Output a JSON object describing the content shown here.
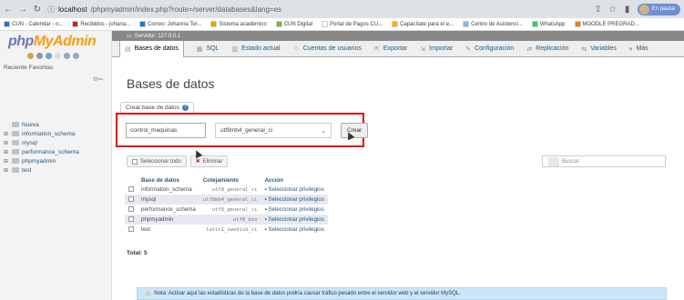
{
  "browser": {
    "url_host": "localhost",
    "url_path": "/phpmyadmin/index.php?route=/server/databases&lang=es",
    "profile_label": "En pausa"
  },
  "bookmarks": [
    {
      "label": "CUN - Calendar - o...",
      "color": "#2b6fd6"
    },
    {
      "label": "Recibidos - johana...",
      "color": "#c5221f"
    },
    {
      "label": "Correo: Johanna Ter...",
      "color": "#1a73e8"
    },
    {
      "label": "Sistema académico",
      "color": "#e8a400"
    },
    {
      "label": "CUN Digital",
      "color": "#7cb342"
    },
    {
      "label": "Portal de Pagos CU...",
      "color": "#ffffff"
    },
    {
      "label": "Capacítate para el e...",
      "color": "#ffb300"
    },
    {
      "label": "Centro de Asistenci...",
      "color": "#8ab4f8"
    },
    {
      "label": "WhatsApp",
      "color": "#25d366"
    },
    {
      "label": "MOODLE PREGRAD...",
      "color": "#f57c00"
    }
  ],
  "sidebar": {
    "logo_php": "php",
    "logo_myadmin": "MyAdmin",
    "recent_label": "Reciente",
    "favorites_label": "Favoritas",
    "tree": [
      {
        "label": "Nueva",
        "kind": "new"
      },
      {
        "label": "information_schema",
        "kind": "db"
      },
      {
        "label": "mysql",
        "kind": "db"
      },
      {
        "label": "performance_schema",
        "kind": "db"
      },
      {
        "label": "phpmyadmin",
        "kind": "db"
      },
      {
        "label": "test",
        "kind": "db"
      }
    ]
  },
  "serverbar": {
    "label": "Servidor: 127.0.0.1"
  },
  "tabs": [
    {
      "label": "Bases de datos",
      "active": true
    },
    {
      "label": "SQL",
      "active": false
    },
    {
      "label": "Estado actual",
      "active": false
    },
    {
      "label": "Cuentas de usuarios",
      "active": false
    },
    {
      "label": "Exportar",
      "active": false
    },
    {
      "label": "Importar",
      "active": false
    },
    {
      "label": "Configuración",
      "active": false
    },
    {
      "label": "Replicación",
      "active": false
    },
    {
      "label": "Variables",
      "active": false
    },
    {
      "label": "Más",
      "active": false
    }
  ],
  "main": {
    "title": "Bases de datos",
    "create_legend": "Crear base de datos",
    "db_name_value": "control_maquinas",
    "collation_value": "utf8mb4_general_ci",
    "create_button": "Crear",
    "select_all": "Seleccionar todo",
    "delete": "Eliminar",
    "search_placeholder": "Buscar",
    "table_headers": [
      "Base de datos",
      "Cotejamiento",
      "Acción"
    ],
    "databases": [
      {
        "name": "information_schema",
        "collation": "utf8_general_ci",
        "action": "Seleccionar privilegios"
      },
      {
        "name": "mysql",
        "collation": "utf8mb4_general_ci",
        "action": "Seleccionar privilegios"
      },
      {
        "name": "performance_schema",
        "collation": "utf8_general_ci",
        "action": "Seleccionar privilegios"
      },
      {
        "name": "phpmyadmin",
        "collation": "utf8_bin",
        "action": "Seleccionar privilegios"
      },
      {
        "name": "test",
        "collation": "latin1_swedish_ci",
        "action": "Seleccionar privilegios"
      }
    ],
    "total": "Total: 5",
    "note": "Nota: Activar aquí las estadísticas de la base de datos podría causar tráfico pesado entre el servidor web y el servidor MySQL."
  },
  "colors": {
    "highlight_border": "#e00a0a",
    "link": "#235a81"
  }
}
